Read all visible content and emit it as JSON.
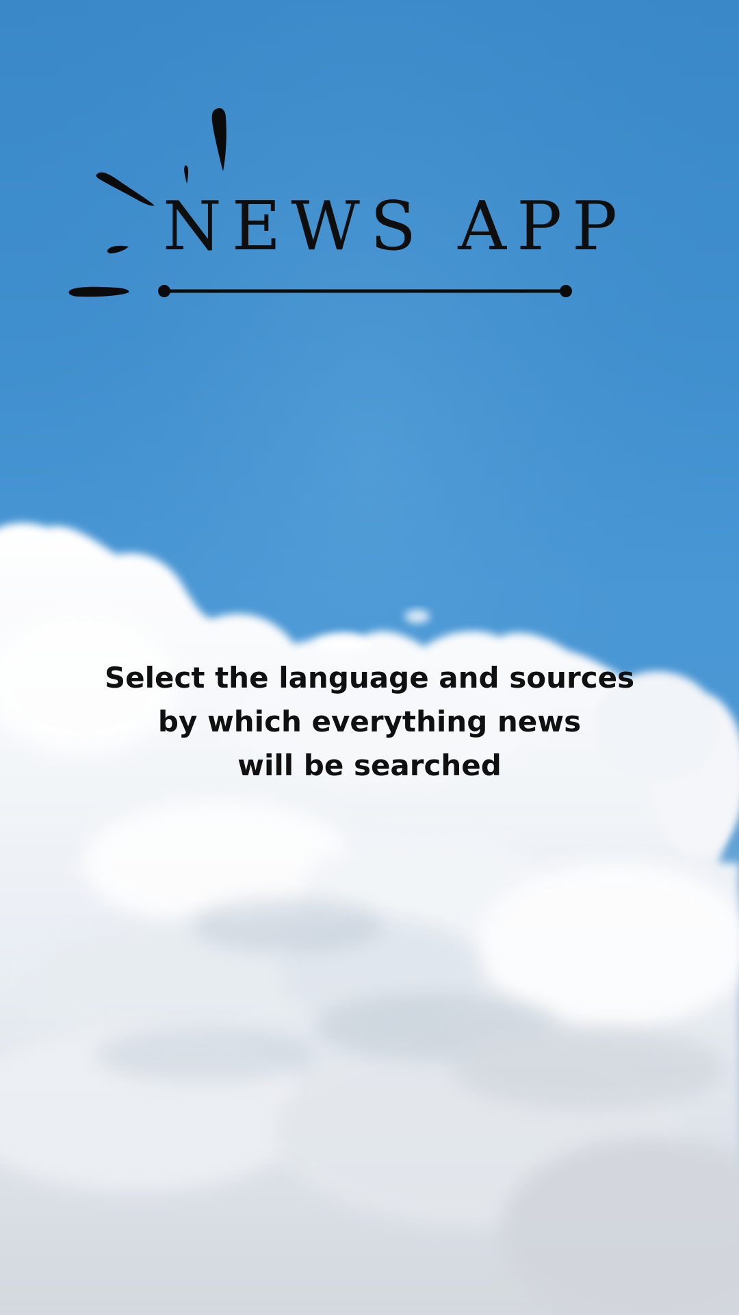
{
  "app": {
    "title": "NEWS APP",
    "logo_icon": "sparkle-accent-icon",
    "underline_icon": "title-underline-icon"
  },
  "instruction": {
    "lines": [
      "Select the language and sources",
      "by which everything news",
      "will be searched"
    ]
  },
  "background": {
    "description_icon": "cloud-sky-background",
    "sky_color": "#3f8ecd",
    "cloud_color": "#f2f4f7"
  }
}
